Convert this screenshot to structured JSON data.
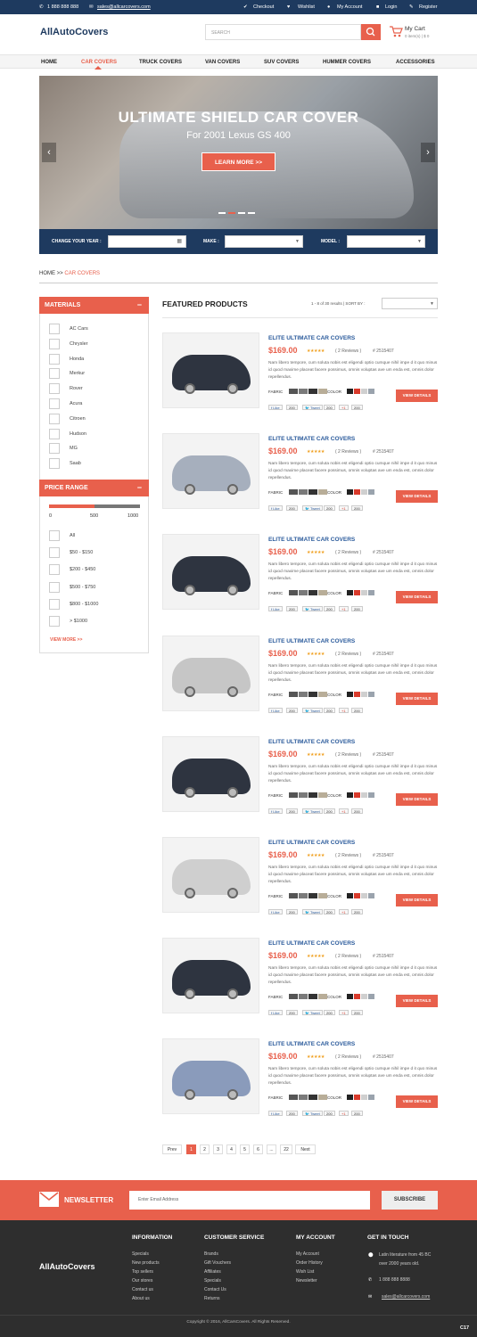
{
  "topbar": {
    "phone": "1 888 888 888",
    "email": "sales@allcarcovers.com",
    "checkout": "Checkout",
    "wishlist": "Wishlist",
    "my_account": "My Account",
    "login": "Login",
    "register": "Register"
  },
  "header": {
    "logo": "AllAutoCovers",
    "search_placeholder": "SEARCH",
    "cart_title": "My Cart",
    "cart_sub": "0 item(s) | $ 0"
  },
  "nav": [
    "HOME",
    "CAR COVERS",
    "TRUCK COVERS",
    "VAN COVERS",
    "SUV COVERS",
    "HUMMER COVERS",
    "ACCESSORIES"
  ],
  "hero": {
    "title": "ULTIMATE SHIELD CAR COVER",
    "subtitle": "For 2001 Lexus GS 400",
    "button": "LEARN MORE >>",
    "prev": "‹",
    "next": "›"
  },
  "filters": {
    "year_label": "CHANGE YOUR YEAR :",
    "make_label": "MAKE :",
    "model_label": "MODEL :"
  },
  "breadcrumb": {
    "home": "HOME",
    "sep": ">>",
    "current": "CAR COVERS"
  },
  "sidebar": {
    "materials_title": "MATERIALS",
    "materials": [
      "AC Cars",
      "Chrysler",
      "Honda",
      "Merkur",
      "Rover",
      "Acura",
      "Citroen",
      "Hudson",
      "MG",
      "Saab"
    ],
    "price_title": "PRICE RANGE",
    "range_min": "0",
    "range_mid": "500",
    "range_max": "1000",
    "range_fill": 0.5,
    "prices": [
      "All",
      "$50 - $150",
      "$200 - $450",
      "$500 - $750",
      "$800 - $1000",
      "> $1000"
    ],
    "view_more": "VIEW MORE >>"
  },
  "products_header": {
    "title": "FEATURED PRODUCTS",
    "results": "1 - 8 of 30 results  |  SORT BY :"
  },
  "product": {
    "name": "ELITE ULTIMATE CAR COVERS",
    "price": "$169.00",
    "stars": "★★★★★",
    "reviews": "( 2 Reviews )",
    "sku": "# 2515407",
    "desc": "Nam libero tempore, cum soluta nobis est eligendi optio cumque nihil impe d it quo minus id quod maxime placeat facere possimus, omnis voluptas ave um enda est, omnis dolor repellendus.",
    "fabric": "FABRIC",
    "color": "COLOR",
    "button": "VIEW DETAILS",
    "like": "Like",
    "like_count": "200",
    "tweet": "Tweet",
    "tweet_count": "200",
    "gplus": "+1",
    "gplus_count": "200",
    "fabric_colors": [
      "#555555",
      "#7a7a7a",
      "#333333",
      "#b8ad98"
    ],
    "swatch_colors": [
      "#222222",
      "#d93a2b",
      "#cfcfcf",
      "#9aa3ad"
    ]
  },
  "cover_colors": [
    "#2e3440",
    "#a6afbd",
    "#2e3440",
    "#c6c6c6",
    "#2e3440",
    "#cfcfcf",
    "#2e3440",
    "#8a9bbb"
  ],
  "pager": [
    "Prev",
    "1",
    "2",
    "3",
    "4",
    "5",
    "6",
    "...",
    "22",
    "Next"
  ],
  "newsletter": {
    "title": "NEWSLETTER",
    "placeholder": "Enter Email Address",
    "button": "SUBSCRIBE"
  },
  "footer": {
    "logo": "AllAutoCovers",
    "information_title": "INFORMATION",
    "information": [
      "Specials",
      "New products",
      "Top sellers",
      "Our stores",
      "Contact us",
      "About us"
    ],
    "service_title": "CUSTOMER SERVICE",
    "service": [
      "Brands",
      "Gift Vouchers",
      "Affiliates",
      "Specials",
      "Contact Us",
      "Returns"
    ],
    "account_title": "MY ACCOUNT",
    "account": [
      "My Account",
      "Order History",
      "Wish List",
      "Newsletter"
    ],
    "touch_title": "GET IN TOUCH",
    "address_1": "Latin literature from 45 BC",
    "address_2": "over 2000 years old.",
    "phone": "1 888 888 8888",
    "email": "sales@allcarcovers.com",
    "copyright": "Copyright © 2016, AllCarsCovers. All Rights Reserved.",
    "badge": "C17"
  }
}
